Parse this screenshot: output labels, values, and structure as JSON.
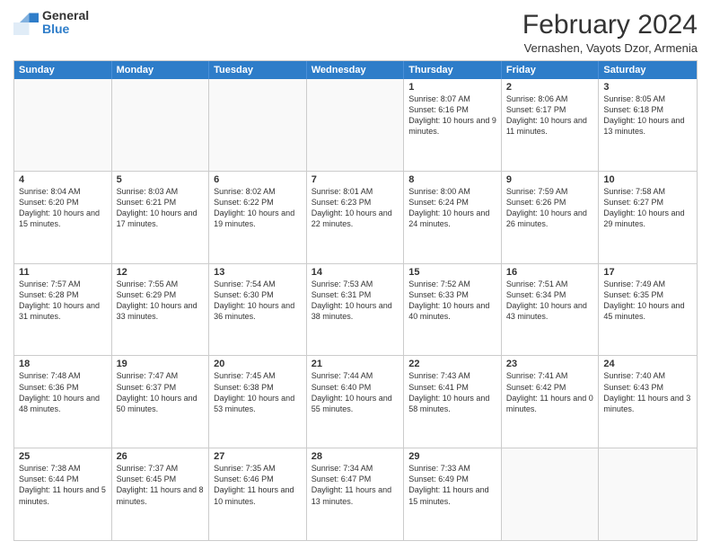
{
  "header": {
    "logo_line1": "General",
    "logo_line2": "Blue",
    "title": "February 2024",
    "subtitle": "Vernashen, Vayots Dzor, Armenia"
  },
  "weekdays": [
    "Sunday",
    "Monday",
    "Tuesday",
    "Wednesday",
    "Thursday",
    "Friday",
    "Saturday"
  ],
  "rows": [
    [
      {
        "day": "",
        "info": ""
      },
      {
        "day": "",
        "info": ""
      },
      {
        "day": "",
        "info": ""
      },
      {
        "day": "",
        "info": ""
      },
      {
        "day": "1",
        "info": "Sunrise: 8:07 AM\nSunset: 6:16 PM\nDaylight: 10 hours and 9 minutes."
      },
      {
        "day": "2",
        "info": "Sunrise: 8:06 AM\nSunset: 6:17 PM\nDaylight: 10 hours and 11 minutes."
      },
      {
        "day": "3",
        "info": "Sunrise: 8:05 AM\nSunset: 6:18 PM\nDaylight: 10 hours and 13 minutes."
      }
    ],
    [
      {
        "day": "4",
        "info": "Sunrise: 8:04 AM\nSunset: 6:20 PM\nDaylight: 10 hours and 15 minutes."
      },
      {
        "day": "5",
        "info": "Sunrise: 8:03 AM\nSunset: 6:21 PM\nDaylight: 10 hours and 17 minutes."
      },
      {
        "day": "6",
        "info": "Sunrise: 8:02 AM\nSunset: 6:22 PM\nDaylight: 10 hours and 19 minutes."
      },
      {
        "day": "7",
        "info": "Sunrise: 8:01 AM\nSunset: 6:23 PM\nDaylight: 10 hours and 22 minutes."
      },
      {
        "day": "8",
        "info": "Sunrise: 8:00 AM\nSunset: 6:24 PM\nDaylight: 10 hours and 24 minutes."
      },
      {
        "day": "9",
        "info": "Sunrise: 7:59 AM\nSunset: 6:26 PM\nDaylight: 10 hours and 26 minutes."
      },
      {
        "day": "10",
        "info": "Sunrise: 7:58 AM\nSunset: 6:27 PM\nDaylight: 10 hours and 29 minutes."
      }
    ],
    [
      {
        "day": "11",
        "info": "Sunrise: 7:57 AM\nSunset: 6:28 PM\nDaylight: 10 hours and 31 minutes."
      },
      {
        "day": "12",
        "info": "Sunrise: 7:55 AM\nSunset: 6:29 PM\nDaylight: 10 hours and 33 minutes."
      },
      {
        "day": "13",
        "info": "Sunrise: 7:54 AM\nSunset: 6:30 PM\nDaylight: 10 hours and 36 minutes."
      },
      {
        "day": "14",
        "info": "Sunrise: 7:53 AM\nSunset: 6:31 PM\nDaylight: 10 hours and 38 minutes."
      },
      {
        "day": "15",
        "info": "Sunrise: 7:52 AM\nSunset: 6:33 PM\nDaylight: 10 hours and 40 minutes."
      },
      {
        "day": "16",
        "info": "Sunrise: 7:51 AM\nSunset: 6:34 PM\nDaylight: 10 hours and 43 minutes."
      },
      {
        "day": "17",
        "info": "Sunrise: 7:49 AM\nSunset: 6:35 PM\nDaylight: 10 hours and 45 minutes."
      }
    ],
    [
      {
        "day": "18",
        "info": "Sunrise: 7:48 AM\nSunset: 6:36 PM\nDaylight: 10 hours and 48 minutes."
      },
      {
        "day": "19",
        "info": "Sunrise: 7:47 AM\nSunset: 6:37 PM\nDaylight: 10 hours and 50 minutes."
      },
      {
        "day": "20",
        "info": "Sunrise: 7:45 AM\nSunset: 6:38 PM\nDaylight: 10 hours and 53 minutes."
      },
      {
        "day": "21",
        "info": "Sunrise: 7:44 AM\nSunset: 6:40 PM\nDaylight: 10 hours and 55 minutes."
      },
      {
        "day": "22",
        "info": "Sunrise: 7:43 AM\nSunset: 6:41 PM\nDaylight: 10 hours and 58 minutes."
      },
      {
        "day": "23",
        "info": "Sunrise: 7:41 AM\nSunset: 6:42 PM\nDaylight: 11 hours and 0 minutes."
      },
      {
        "day": "24",
        "info": "Sunrise: 7:40 AM\nSunset: 6:43 PM\nDaylight: 11 hours and 3 minutes."
      }
    ],
    [
      {
        "day": "25",
        "info": "Sunrise: 7:38 AM\nSunset: 6:44 PM\nDaylight: 11 hours and 5 minutes."
      },
      {
        "day": "26",
        "info": "Sunrise: 7:37 AM\nSunset: 6:45 PM\nDaylight: 11 hours and 8 minutes."
      },
      {
        "day": "27",
        "info": "Sunrise: 7:35 AM\nSunset: 6:46 PM\nDaylight: 11 hours and 10 minutes."
      },
      {
        "day": "28",
        "info": "Sunrise: 7:34 AM\nSunset: 6:47 PM\nDaylight: 11 hours and 13 minutes."
      },
      {
        "day": "29",
        "info": "Sunrise: 7:33 AM\nSunset: 6:49 PM\nDaylight: 11 hours and 15 minutes."
      },
      {
        "day": "",
        "info": ""
      },
      {
        "day": "",
        "info": ""
      }
    ]
  ]
}
